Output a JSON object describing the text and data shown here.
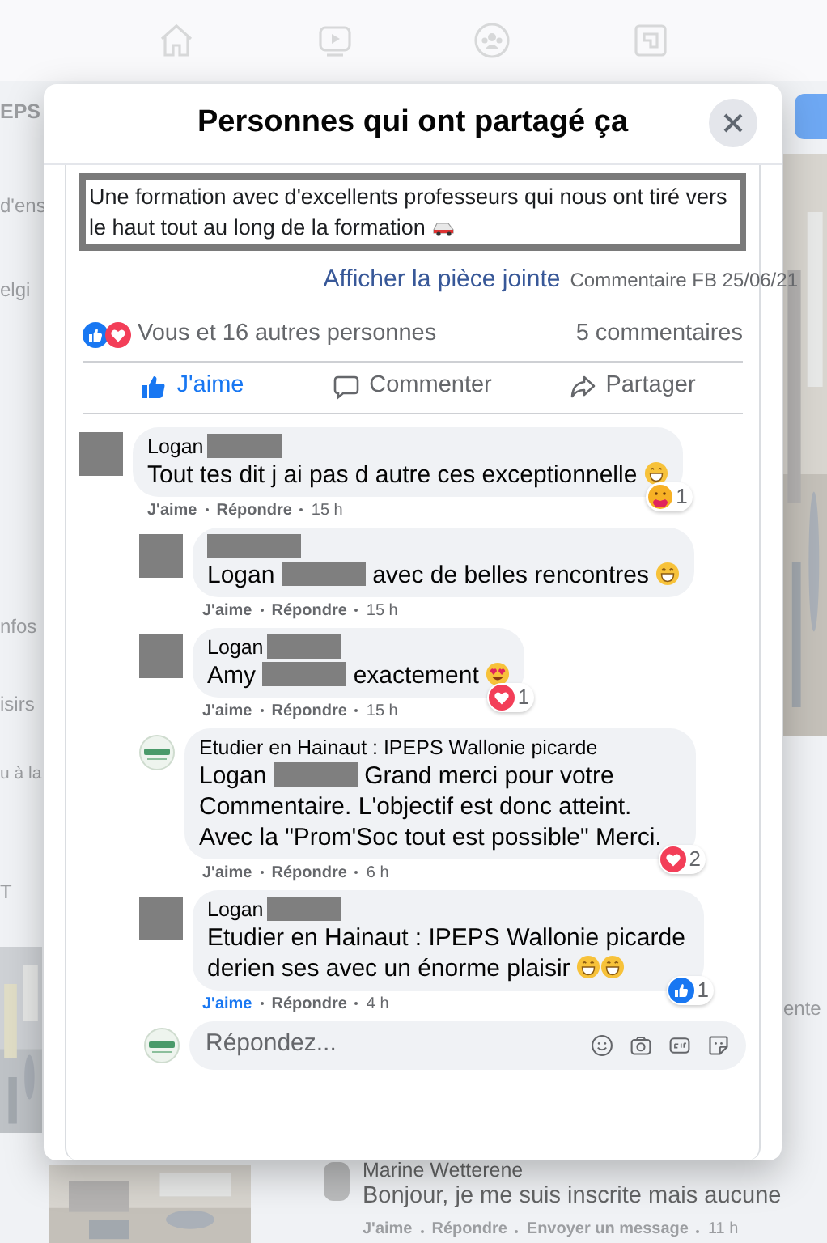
{
  "nav": {
    "icons": [
      {
        "kind": "home"
      },
      {
        "kind": "video"
      },
      {
        "kind": "groups"
      },
      {
        "kind": "gaming"
      }
    ]
  },
  "background": {
    "left_texts": [
      "EPS",
      "d'ens",
      "elgi",
      "nfos",
      "isirs",
      "u à la",
      "T"
    ],
    "right_text": "ente",
    "comment": {
      "author": "Marine Wetterene",
      "text": "Bonjour, je me suis inscrite mais aucune",
      "actions": [
        "J'aime",
        "Répondre",
        "Envoyer un message",
        "11 h"
      ]
    }
  },
  "dialog": {
    "title": "Personnes qui ont partagé ça",
    "post": {
      "quote": "Une formation avec d'excellents professeurs qui nous ont tiré vers le haut tout au long de la formation",
      "quote_emoji": {
        "kind": "car"
      },
      "link": "Afficher la pièce jointe",
      "note": "Commentaire FB 25/06/21",
      "reactions": "Vous et 16 autres personnes",
      "comments_count": "5 commentaires",
      "actions": [
        {
          "kind": "like",
          "label": "J'aime",
          "selected": true
        },
        {
          "kind": "comment",
          "label": "Commenter",
          "selected": false
        },
        {
          "kind": "share",
          "label": "Partager",
          "selected": false
        }
      ]
    },
    "comments": [
      {
        "avatar": {
          "kind": "redacted"
        },
        "author": "Logan",
        "author_redacted": true,
        "parts": [
          {
            "kind": "text",
            "text": "Tout tes dit j ai pas d autre ces exceptionnelle"
          }
        ],
        "emojis": [
          {
            "kind": "grin"
          }
        ],
        "reaction": {
          "kind": "care",
          "count": "1"
        },
        "like_label": "J'aime",
        "reply_label": "Répondre",
        "time": "15 h",
        "liked": false,
        "replies": [
          {
            "avatar": {
              "kind": "redacted"
            },
            "author_redacted": true,
            "parts": [
              {
                "kind": "mention",
                "text": "Logan"
              },
              {
                "kind": "redacted"
              },
              {
                "kind": "text",
                "text": "avec de belles rencontres"
              }
            ],
            "emojis": [
              {
                "kind": "grin"
              }
            ],
            "like_label": "J'aime",
            "reply_label": "Répondre",
            "time": "15 h",
            "liked": false
          },
          {
            "avatar": {
              "kind": "redacted"
            },
            "author": "Logan",
            "author_redacted": true,
            "parts": [
              {
                "kind": "mention",
                "text": "Amy"
              },
              {
                "kind": "redacted"
              },
              {
                "kind": "text",
                "text": "exactement"
              }
            ],
            "emojis": [
              {
                "kind": "heart-eyes"
              }
            ],
            "reaction": {
              "kind": "love",
              "count": "1"
            },
            "like_label": "J'aime",
            "reply_label": "Répondre",
            "time": "15 h",
            "liked": false
          },
          {
            "avatar": {
              "kind": "logo"
            },
            "author": "Etudier en Hainaut : IPEPS Wallonie picarde",
            "author_redacted": false,
            "parts": [
              {
                "kind": "mention",
                "text": "Logan"
              },
              {
                "kind": "redacted"
              },
              {
                "kind": "text",
                "text": "Grand merci pour votre Commentaire. L'objectif est donc atteint. Avec la \"Prom'Soc tout est possible\" Merci."
              }
            ],
            "reaction": {
              "kind": "love",
              "count": "2"
            },
            "like_label": "J'aime",
            "reply_label": "Répondre",
            "time": "6 h",
            "liked": false
          },
          {
            "avatar": {
              "kind": "redacted"
            },
            "author": "Logan",
            "author_redacted": true,
            "parts": [
              {
                "kind": "mention",
                "text": "Etudier en Hainaut : IPEPS Wallonie picarde"
              },
              {
                "kind": "text",
                "text": "derien ses avec un énorme plaisir"
              }
            ],
            "emojis": [
              {
                "kind": "grin"
              },
              {
                "kind": "grin"
              }
            ],
            "reaction": {
              "kind": "like",
              "count": "1"
            },
            "like_label": "J'aime",
            "reply_label": "Répondre",
            "time": "4 h",
            "liked": true
          }
        ]
      }
    ],
    "reply_field": {
      "avatar": {
        "kind": "logo"
      },
      "placeholder": "Répondez...",
      "icons": [
        {
          "kind": "smiley"
        },
        {
          "kind": "camera"
        },
        {
          "kind": "gif"
        },
        {
          "kind": "sticker"
        }
      ]
    }
  }
}
